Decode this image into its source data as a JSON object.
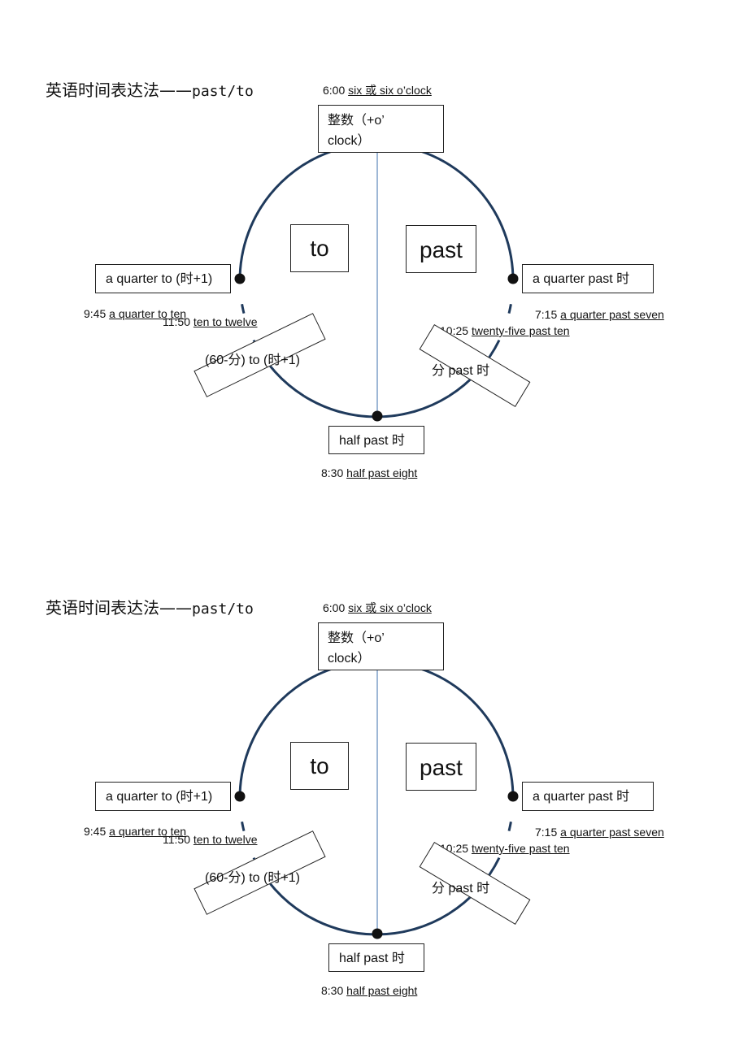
{
  "colors": {
    "circle": "#1f3a5c",
    "divider": "#7f9fc8",
    "dot": "#111111",
    "text": "#111111"
  },
  "diagrams": [
    {
      "title_cn": "英语时间表达法——",
      "title_en": "past/to",
      "top": {
        "time": "6:00",
        "words": "six 或 six o’clock",
        "box_line1": "整数（+o’",
        "box_line2": "clock）"
      },
      "to_label": "to",
      "past_label": "past",
      "left_box": "a quarter to (时+1)",
      "left_example": {
        "time": "9:45",
        "words": "a quarter to ten"
      },
      "left_lower_example": {
        "time": "11:50",
        "words": "ten to twelve"
      },
      "left_lower_box": "(60-分) to (时+1)",
      "right_box": "a quarter past  时",
      "right_example": {
        "time": "7:15",
        "words": "a quarter past seven"
      },
      "right_lower_example": {
        "time": "10:25",
        "words": "twenty-five past ten"
      },
      "right_lower_box": "分  past  时",
      "bottom_box": "half past  时",
      "bottom_example": {
        "time": "8:30",
        "words": "half past eight"
      }
    },
    {
      "title_cn": "英语时间表达法——",
      "title_en": "past/to",
      "top": {
        "time": "6:00",
        "words": "six 或 six o’clock",
        "box_line1": "整数（+o’",
        "box_line2": "clock）"
      },
      "to_label": "to",
      "past_label": "past",
      "left_box": "a quarter to (时+1)",
      "left_example": {
        "time": "9:45",
        "words": "a quarter to ten"
      },
      "left_lower_example": {
        "time": "11:50",
        "words": "ten to twelve"
      },
      "left_lower_box": "(60-分) to (时+1)",
      "right_box": "a quarter past  时",
      "right_example": {
        "time": "7:15",
        "words": "a quarter past seven"
      },
      "right_lower_example": {
        "time": "10:25",
        "words": "twenty-five past ten"
      },
      "right_lower_box": "分  past  时",
      "bottom_box": "half past  时",
      "bottom_example": {
        "time": "8:30",
        "words": "half past eight"
      }
    }
  ]
}
